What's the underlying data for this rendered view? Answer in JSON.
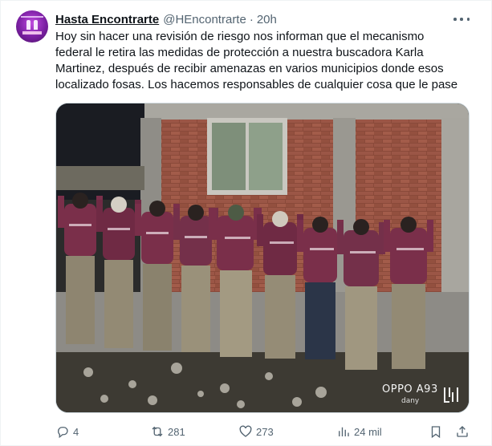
{
  "author": {
    "name": "Hasta Encontrarte",
    "handle": "@HEncontrarte",
    "separator": "·",
    "time": "20h"
  },
  "tweet": {
    "lines": [
      "Hoy sin hacer una revisión de riesgo nos informan que el mecanismo",
      "federal le retira las medidas de protección a nuestra buscadora Karla",
      "Martinez, después de recibir amenazas en varios municipios donde esos",
      "localizado fosas.  Los hacemos responsables de cualquier cosa que le pase"
    ]
  },
  "media": {
    "watermark_model": "OPPO A93",
    "watermark_user": "dany",
    "shirt_color": "#7a2f4a",
    "pants_color": "#8e8570"
  },
  "actions": {
    "replies": "4",
    "reposts": "281",
    "likes": "273",
    "views": "24 mil"
  },
  "icons": [
    "reply-icon",
    "repost-icon",
    "like-icon",
    "views-icon",
    "bookmark-icon",
    "share-icon",
    "more-icon"
  ]
}
